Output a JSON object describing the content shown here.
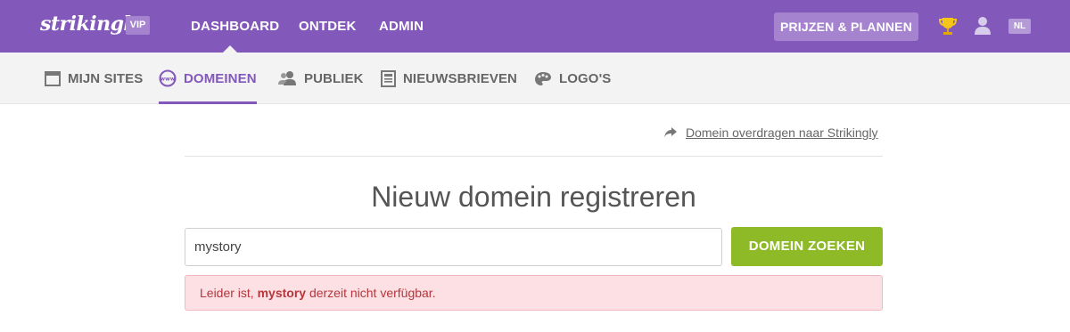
{
  "header": {
    "logo_text": "strikingly",
    "vip_badge": "VIP",
    "nav": [
      "DASHBOARD",
      "ONTDEK",
      "ADMIN"
    ],
    "pricing_button": "PRIJZEN & PLANNEN",
    "language": "NL"
  },
  "subnav": {
    "items": [
      {
        "label": "MIJN SITES",
        "icon": "browser-window-icon"
      },
      {
        "label": "DOMEINEN",
        "icon": "www-globe-icon",
        "active": true
      },
      {
        "label": "PUBLIEK",
        "icon": "people-icon"
      },
      {
        "label": "NIEUWSBRIEVEN",
        "icon": "newsletter-icon"
      },
      {
        "label": "LOGO'S",
        "icon": "palette-icon"
      }
    ]
  },
  "main": {
    "transfer_link": "Domein overdragen naar Strikingly",
    "title": "Nieuw domein registreren",
    "search_value": "mystory",
    "search_button": "DOMEIN ZOEKEN",
    "alert": {
      "prefix": "Leider ist, ",
      "domain": "mystory",
      "suffix": " derzeit nicht verfügbar."
    }
  },
  "colors": {
    "brand_purple": "#8358bb",
    "button_green": "#8dba26",
    "alert_bg": "#fde0e3",
    "alert_text": "#b5363d"
  }
}
